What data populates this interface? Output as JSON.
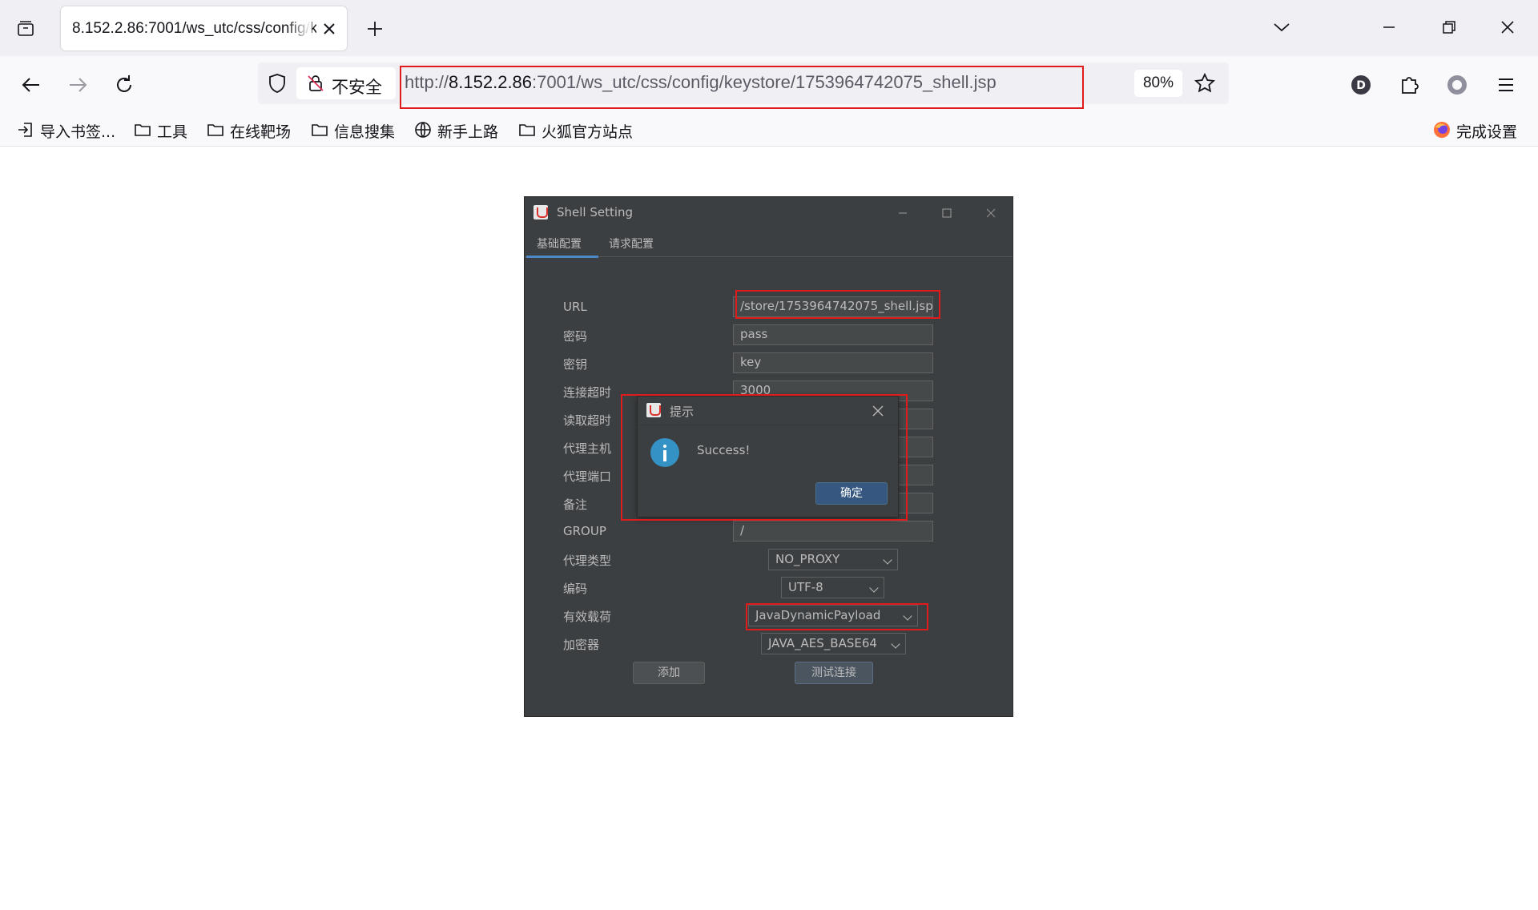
{
  "browser": {
    "tab_title": "8.152.2.86:7001/ws_utc/css/config/keystore/1753964742075_shell.jsp",
    "security_label": "不安全",
    "url_prefix": "http://",
    "url_host": "8.152.2.86",
    "url_rest": ":7001/ws_utc/css/config/keystore/1753964742075_shell.jsp",
    "zoom": "80%",
    "profile_initial": "D",
    "bookmarks": [
      "导入书签...",
      "工具",
      "在线靶场",
      "信息搜集",
      "新手上路",
      "火狐官方站点"
    ],
    "finish_setup": "完成设置"
  },
  "shell_window": {
    "title": "Shell Setting",
    "tabs": [
      "基础配置",
      "请求配置"
    ],
    "fields": {
      "url_label": "URL",
      "url_value": "/store/1753964742075_shell.jsp",
      "password_label": "密码",
      "password_value": "pass",
      "key_label": "密钥",
      "key_value": "key",
      "conn_timeout_label": "连接超时",
      "conn_timeout_value": "3000",
      "read_timeout_label": "读取超时",
      "proxy_host_label": "代理主机",
      "proxy_port_label": "代理端口",
      "remark_label": "备注",
      "group_label": "GROUP",
      "group_value": "/",
      "proxy_type_label": "代理类型",
      "proxy_type_value": "NO_PROXY",
      "encoding_label": "编码",
      "encoding_value": "UTF-8",
      "payload_label": "有效载荷",
      "payload_value": "JavaDynamicPayload",
      "crypto_label": "加密器",
      "crypto_value": "JAVA_AES_BASE64"
    },
    "add_button": "添加",
    "test_button": "测试连接"
  },
  "dialog": {
    "title": "提示",
    "message": "Success!",
    "ok_button": "确定"
  }
}
